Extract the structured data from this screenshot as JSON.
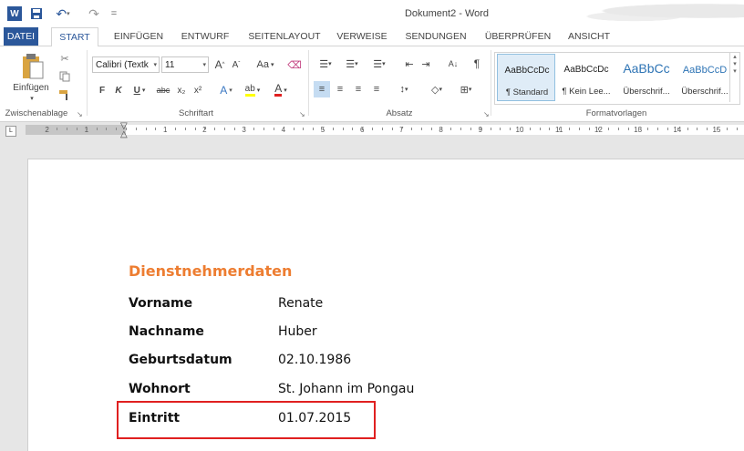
{
  "window": {
    "title": "Dokument2 - Word"
  },
  "quick_access": {
    "logo": "W",
    "undo_glyph": "↶",
    "redo_glyph": "↷",
    "more_glyph": "="
  },
  "tabs": [
    "DATEI",
    "START",
    "EINFÜGEN",
    "ENTWURF",
    "SEITENLAYOUT",
    "VERWEISE",
    "SENDUNGEN",
    "ÜBERPRÜFEN",
    "ANSICHT"
  ],
  "ribbon": {
    "clipboard": {
      "paste_label": "Einfügen",
      "group_label": "Zwischenablage"
    },
    "font": {
      "font_name": "Calibri (Textk",
      "font_size": "11",
      "grow": "A",
      "shrink": "A",
      "case": "Aa",
      "bold": "F",
      "italic": "K",
      "underline": "U",
      "strike": "abc",
      "subscript": "x₂",
      "superscript": "x²",
      "effects": "A",
      "highlight": "ab",
      "color": "A",
      "group_label": "Schriftart"
    },
    "paragraph": {
      "pilcrow": "¶",
      "sort": "A↓",
      "group_label": "Absatz"
    },
    "styles": {
      "items": [
        {
          "sample": "AaBbCcDc",
          "name": "¶ Standard"
        },
        {
          "sample": "AaBbCcDc",
          "name": "¶ Kein Lee..."
        },
        {
          "sample": "AaBbCc",
          "name": "Überschrif..."
        },
        {
          "sample": "AaBbCcD",
          "name": "Überschrif..."
        }
      ],
      "group_label": "Formatvorlagen"
    }
  },
  "ruler": {
    "numbers_left": [
      "2",
      "1"
    ],
    "numbers_right": [
      "1",
      "2",
      "3",
      "4",
      "5",
      "6",
      "7",
      "8",
      "9",
      "10",
      "11",
      "12",
      "13",
      "14",
      "15"
    ]
  },
  "document": {
    "heading": "Dienstnehmerdaten",
    "rows": [
      {
        "label": "Vorname",
        "value": "Renate"
      },
      {
        "label": "Nachname",
        "value": "Huber"
      },
      {
        "label": "Geburtsdatum",
        "value": "02.10.1986"
      },
      {
        "label": "Wohnort",
        "value": "St. Johann im Pongau"
      },
      {
        "label": "Eintritt",
        "value": "01.07.2015"
      }
    ]
  },
  "colors": {
    "accent": "#2b579a",
    "heading": "#ed7d31",
    "highlight_box": "#e02020"
  }
}
